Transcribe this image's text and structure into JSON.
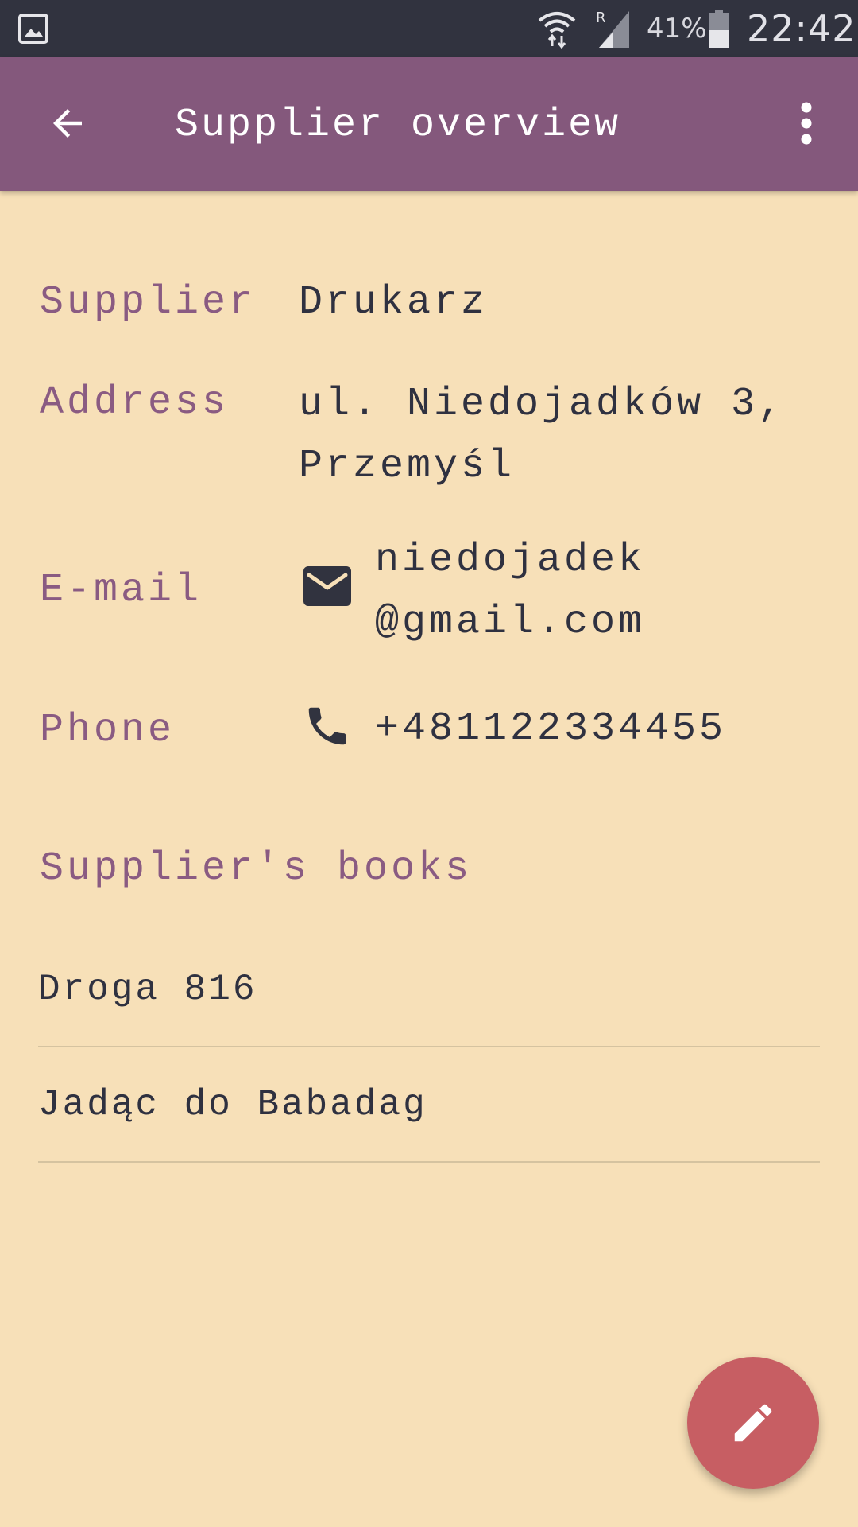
{
  "status_bar": {
    "battery_percent": "41%",
    "time": "22:42",
    "icons": [
      "gallery-icon",
      "wifi-icon",
      "signal-icon",
      "battery-icon"
    ]
  },
  "app_bar": {
    "title": "Supplier overview",
    "icons": [
      "back-arrow-icon",
      "more-vert-icon"
    ]
  },
  "details": {
    "supplier": {
      "label": "Supplier",
      "value": "Drukarz"
    },
    "address": {
      "label": "Address",
      "line1": "ul. Niedojadków 3,",
      "line2": "Przemyśl"
    },
    "email": {
      "label": "E-mail",
      "line1": "niedojadek",
      "line2": "@gmail.com",
      "icon": "email-icon"
    },
    "phone": {
      "label": "Phone",
      "value": "+481122334455",
      "icon": "phone-icon"
    }
  },
  "books_section": {
    "title": "Supplier's books",
    "items": [
      {
        "title": "Droga 816"
      },
      {
        "title": "Jadąc do Babadag"
      }
    ]
  },
  "fab": {
    "icon": "edit-icon"
  },
  "colors": {
    "status_bar": "#31333f",
    "app_bar": "#84587c",
    "background": "#f7e0b8",
    "label_text": "#8a5b82",
    "value_text": "#2f3140",
    "fab": "#c75e63"
  }
}
